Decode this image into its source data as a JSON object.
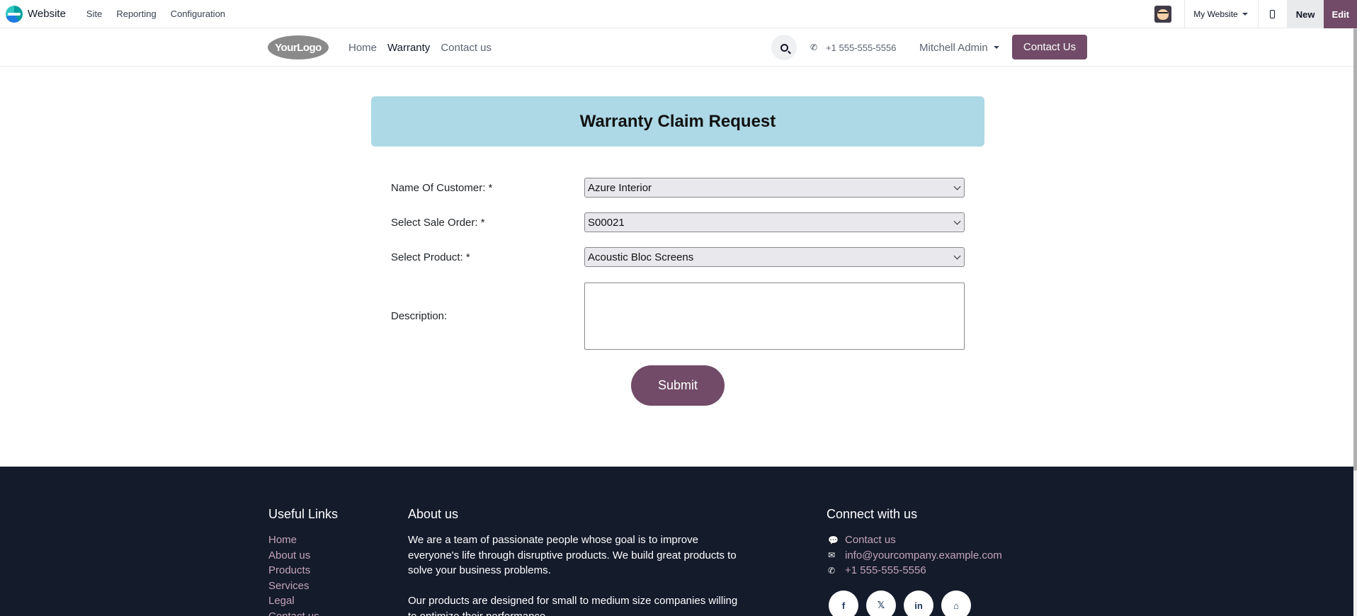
{
  "admin_bar": {
    "app_name": "Website",
    "menu": [
      "Site",
      "Reporting",
      "Configuration"
    ],
    "website_switch": "My Website",
    "new_label": "New",
    "edit_label": "Edit"
  },
  "header": {
    "logo_text": "YourLogo",
    "nav": [
      "Home",
      "Warranty",
      "Contact us"
    ],
    "active_nav": "Warranty",
    "phone": "+1 555-555-5556",
    "user": "Mitchell Admin",
    "contact_button": "Contact Us"
  },
  "form": {
    "title": "Warranty Claim Request",
    "customer_label": "Name Of Customer: *",
    "customer_value": "Azure Interior",
    "sale_order_label": "Select Sale Order: *",
    "sale_order_value": "S00021",
    "product_label": "Select Product: *",
    "product_value": "Acoustic Bloc Screens",
    "description_label": "Description:",
    "description_value": "",
    "submit_label": "Submit"
  },
  "footer": {
    "useful_links_heading": "Useful Links",
    "useful_links": [
      "Home",
      "About us",
      "Products",
      "Services",
      "Legal",
      "Contact us"
    ],
    "about_heading": "About us",
    "about_p1": "We are a team of passionate people whose goal is to improve everyone's life through disruptive products. We build great products to solve your business problems.",
    "about_p2": "Our products are designed for small to medium size companies willing to optimize their performance.",
    "connect_heading": "Connect with us",
    "contact_link": "Contact us",
    "email": "info@yourcompany.example.com",
    "phone": "+1 555-555-5556",
    "social": [
      "f",
      "𝕏",
      "in",
      "⌂"
    ]
  },
  "colors": {
    "brand": "#714b67",
    "banner": "#add8e6",
    "footer_bg": "#141b2b",
    "footer_link": "#c4a4ba"
  },
  "icons": [
    "search-icon",
    "phone-icon",
    "chat-icon",
    "envelope-icon",
    "facebook-icon",
    "x-icon",
    "linkedin-icon",
    "home-icon"
  ]
}
